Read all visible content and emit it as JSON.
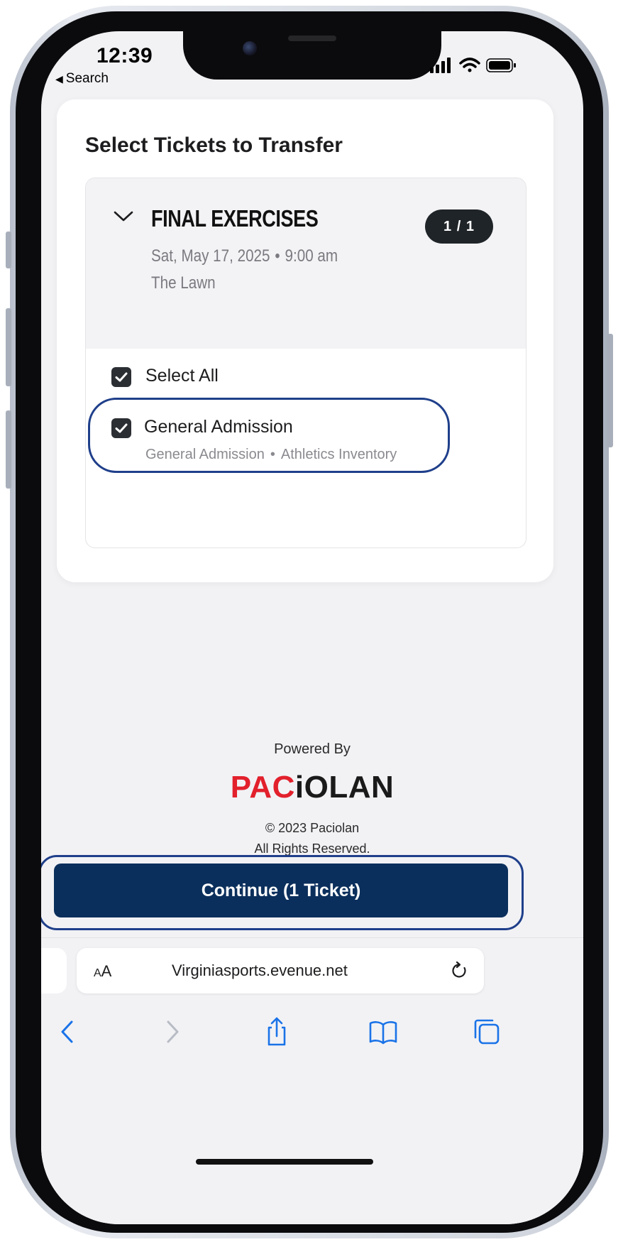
{
  "status_bar": {
    "time": "12:39",
    "back_label": "Search"
  },
  "card": {
    "title": "Select Tickets to Transfer",
    "event": {
      "name": "FINAL EXERCISES",
      "count_badge": "1 / 1",
      "date": "Sat, May 17, 2025",
      "time": "9:00 am",
      "venue": "The Lawn"
    },
    "select_all_label": "Select All",
    "ticket": {
      "name": "General Admission",
      "section": "General Admission",
      "inventory": "Athletics Inventory"
    }
  },
  "footer": {
    "powered_by": "Powered By",
    "logo_red": "PAC",
    "logo_dark": "iOLAN",
    "copyright": "© 2023 Paciolan",
    "rights": "All Rights Reserved."
  },
  "continue_button": {
    "label": "Continue (1 Ticket)"
  },
  "safari": {
    "aa_big": "A",
    "aa_small": "A",
    "url": "Virginiasports.evenue.net"
  },
  "colors": {
    "continue_bg": "#0b2f5c",
    "highlight": "#1f3f8a",
    "logo_red": "#e2202c",
    "ios_blue": "#1a73e8"
  },
  "icons": {
    "chevron": "chevron-down-icon",
    "checkbox": "checkmark-icon",
    "back": "chevron-left-icon",
    "forward": "chevron-right-icon",
    "share": "share-icon",
    "bookmarks": "book-icon",
    "tabs": "tabs-icon",
    "reload": "reload-icon"
  }
}
